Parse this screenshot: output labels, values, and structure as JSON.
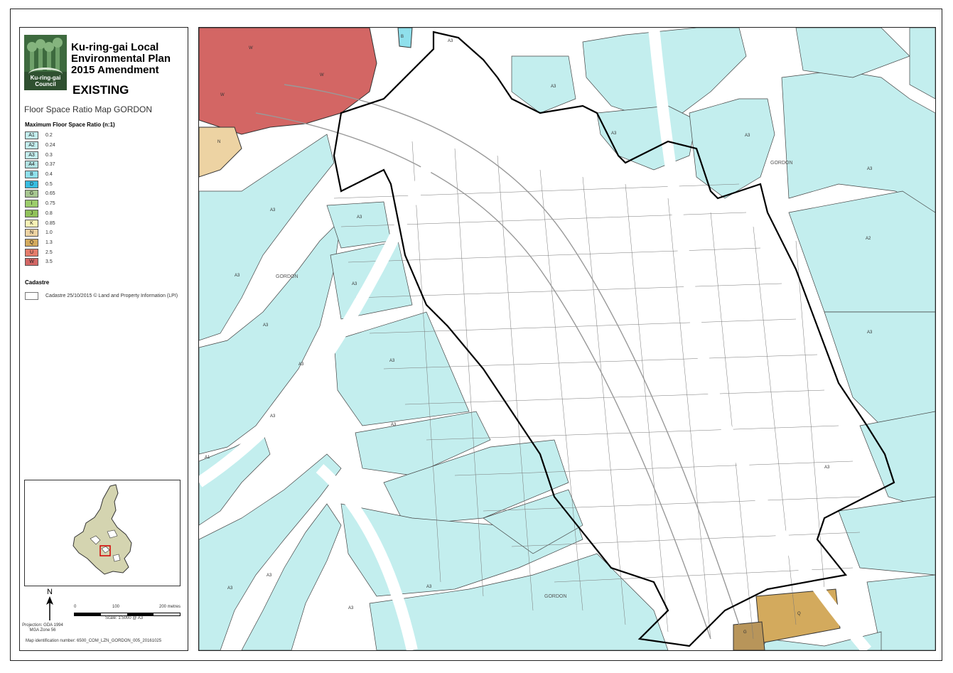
{
  "header": {
    "title_line1": "Ku-ring-gai Local",
    "title_line2": "Environmental Plan",
    "title_line3": "2015 Amendment",
    "status": "EXISTING",
    "map_title": "Floor Space Ratio Map GORDON"
  },
  "logo": {
    "name_line1": "Ku-ring-gai",
    "name_line2": "Council"
  },
  "legend": {
    "heading": "Maximum Floor Space Ratio (n:1)",
    "items": [
      {
        "code": "A1",
        "value": "0.2",
        "color": "#c3eeee"
      },
      {
        "code": "A2",
        "value": "0.24",
        "color": "#c3eeee"
      },
      {
        "code": "A3",
        "value": "0.3",
        "color": "#c3eeee"
      },
      {
        "code": "A4",
        "value": "0.37",
        "color": "#b2e3e3"
      },
      {
        "code": "B",
        "value": "0.4",
        "color": "#8fe0ec"
      },
      {
        "code": "D",
        "value": "0.5",
        "color": "#38bce0"
      },
      {
        "code": "G",
        "value": "0.65",
        "color": "#a7c690"
      },
      {
        "code": "I",
        "value": "0.75",
        "color": "#9ccd6b"
      },
      {
        "code": "J",
        "value": "0.8",
        "color": "#91c25b"
      },
      {
        "code": "K",
        "value": "0.85",
        "color": "#f7f1b5"
      },
      {
        "code": "N",
        "value": "1.0",
        "color": "#edd3a3"
      },
      {
        "code": "Q",
        "value": "1.3",
        "color": "#d3aa5d"
      },
      {
        "code": "U",
        "value": "2.5",
        "color": "#e57c6b"
      },
      {
        "code": "W",
        "value": "3.5",
        "color": "#d36664"
      }
    ],
    "cadastre_heading": "Cadastre",
    "cadastre_text": "Cadastre 25/10/2015 © Land and Property Information (LPI)"
  },
  "north_label": "N",
  "projection_text_1": "Projection: GDA 1994",
  "projection_text_2": "MGA Zone 56",
  "scalebar": {
    "label_0": "0",
    "label_1": "100",
    "label_2": "200 metres"
  },
  "scale_text": "Scale: 1:5000   @ A3",
  "map_id": "Map identification number: 6500_COM_LZN_GORDON_005_20161025",
  "map": {
    "zone_labels": [
      "A1",
      "A3",
      "A3",
      "A3",
      "A3",
      "A3",
      "A3",
      "A3",
      "A3",
      "A3",
      "A3",
      "A3",
      "A3",
      "A2",
      "A3",
      "A3",
      "A3",
      "A3",
      "A3",
      "A3",
      "A3",
      "A3",
      "W",
      "W",
      "W",
      "N",
      "Q",
      "G",
      "B"
    ],
    "place_labels": [
      "GORDON",
      "GORDON",
      "GORDON"
    ]
  }
}
